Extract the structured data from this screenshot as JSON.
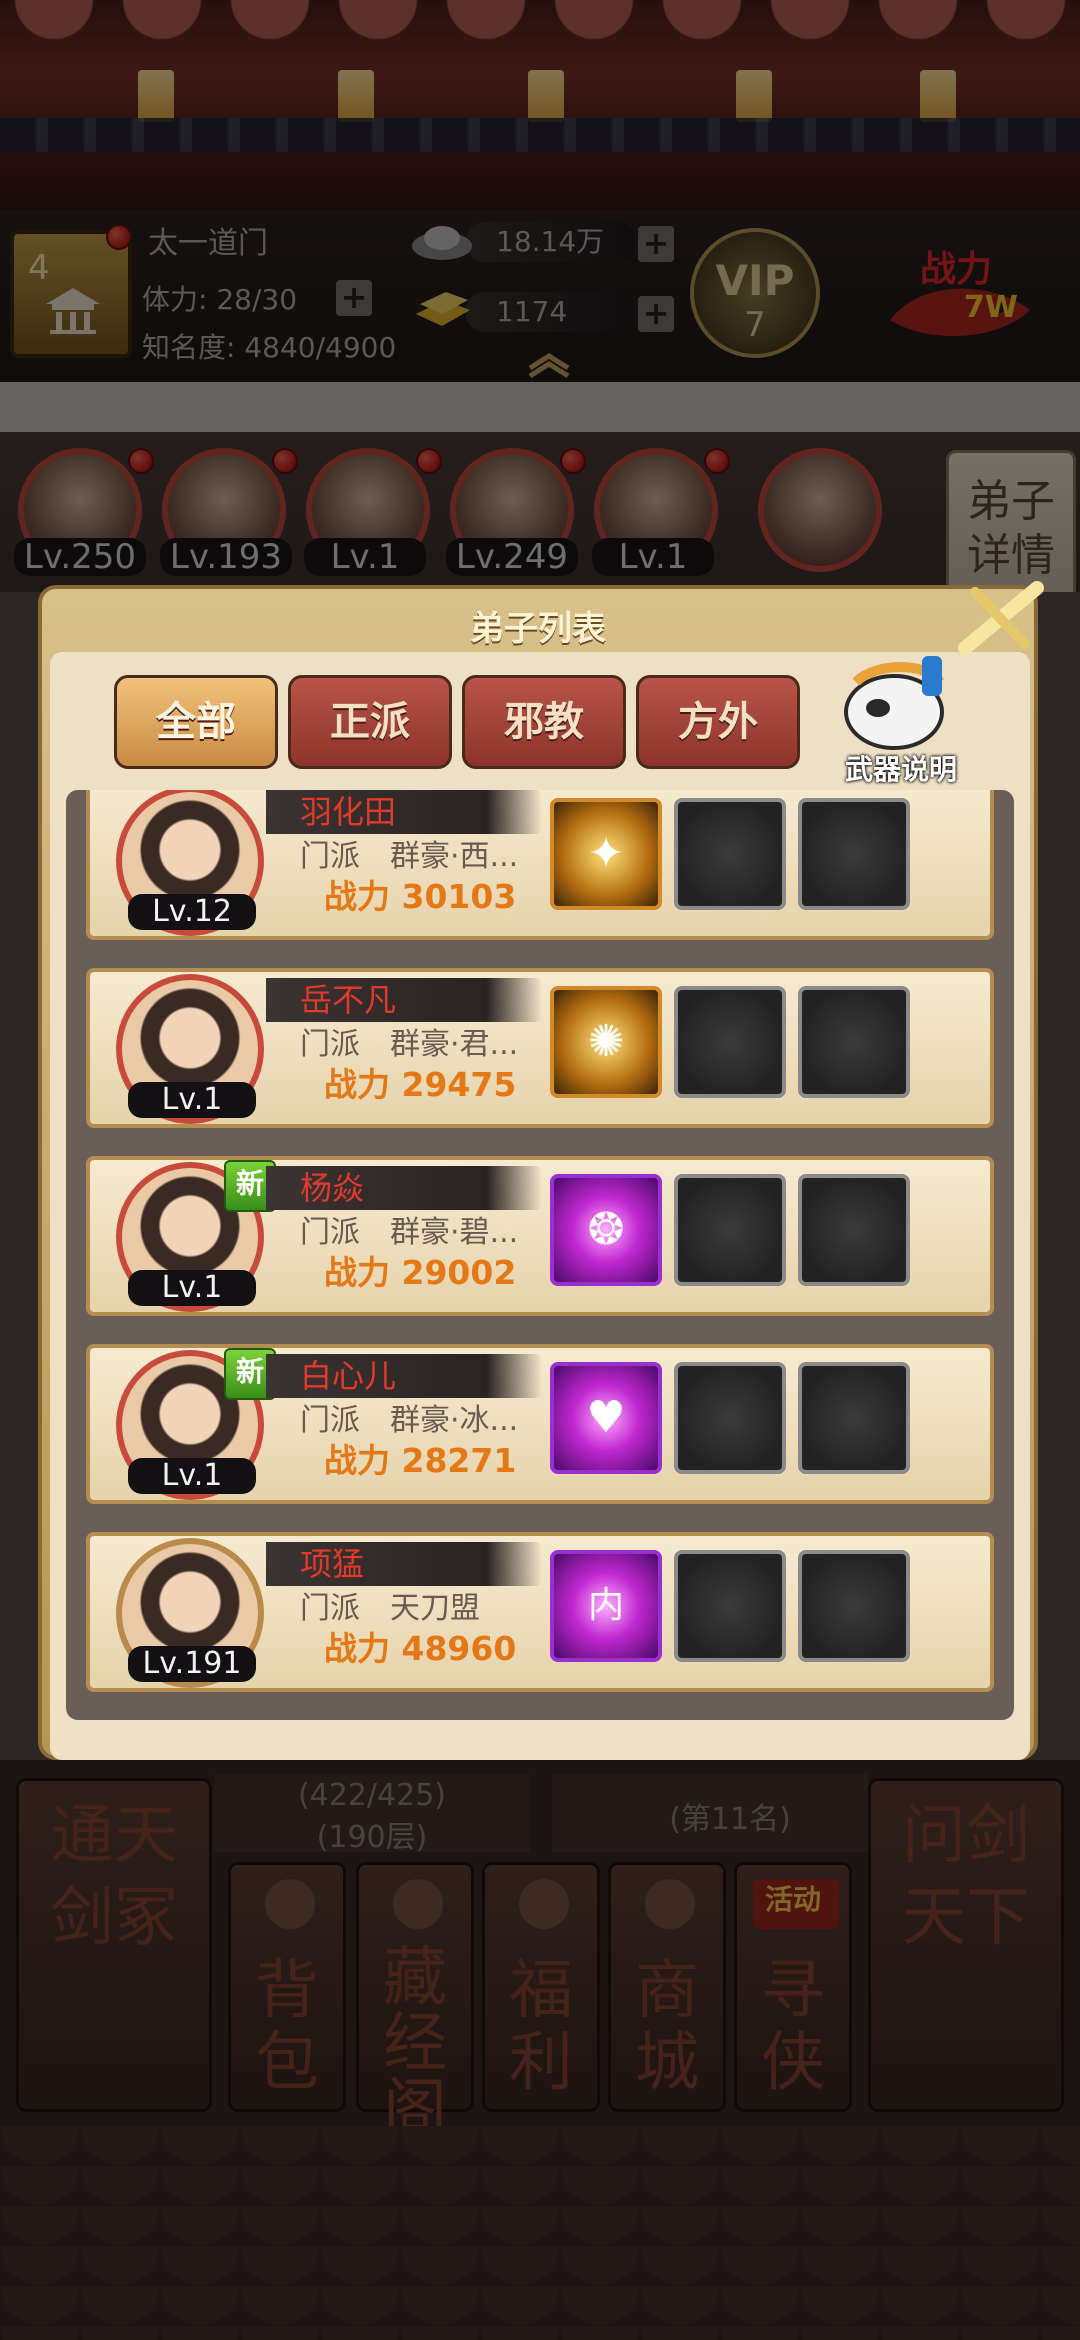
{
  "header": {
    "sect_level": "4",
    "sect_name": "太一道门",
    "stamina": "体力: 28/30",
    "fame": "知名度: 4840/4900",
    "silver": "18.14万",
    "gold": "1174",
    "vip_label": "VIP",
    "vip_level": "7",
    "power_label": "战力",
    "power_value": "7W"
  },
  "avatar_row": {
    "levels": [
      "Lv.250",
      "Lv.193",
      "Lv.1",
      "Lv.249",
      "Lv.1"
    ],
    "detail_button": "弟子详情"
  },
  "dialog": {
    "title": "弟子列表",
    "tabs": [
      "全部",
      "正派",
      "邪教",
      "方外"
    ],
    "active_tab": "全部",
    "weapon_info_label": "武器说明",
    "disciples": [
      {
        "name": "羽化田",
        "level": "Lv.12",
        "sect": "门派　群豪·西...",
        "power_label": "战力",
        "power": "30103",
        "is_new": false,
        "weapon_color": "gold"
      },
      {
        "name": "岳不凡",
        "level": "Lv.1",
        "sect": "门派　群豪·君...",
        "power_label": "战力",
        "power": "29475",
        "is_new": false,
        "weapon_color": "gold"
      },
      {
        "name": "杨焱",
        "level": "Lv.1",
        "sect": "门派　群豪·碧...",
        "power_label": "战力",
        "power": "29002",
        "is_new": true,
        "new_label": "新",
        "weapon_color": "purple"
      },
      {
        "name": "白心儿",
        "level": "Lv.1",
        "sect": "门派　群豪·冰...",
        "power_label": "战力",
        "power": "28271",
        "is_new": true,
        "new_label": "新",
        "weapon_color": "purple"
      },
      {
        "name": "项猛",
        "level": "Lv.191",
        "sect": "门派　天刀盟",
        "power_label": "战力",
        "power": "48960",
        "is_new": false,
        "weapon_color": "purple",
        "weapon_glyph": "内"
      }
    ]
  },
  "bottom_menu": {
    "left_plaque": "通天剑冢",
    "right_plaque": "问剑天下",
    "tower_progress": "(422/425)",
    "tower_floor": "(190层)",
    "rank": "(第11名)",
    "buttons": [
      "背包",
      "藏经阁",
      "福利",
      "商城",
      "寻侠"
    ],
    "event_tag": "活动"
  }
}
